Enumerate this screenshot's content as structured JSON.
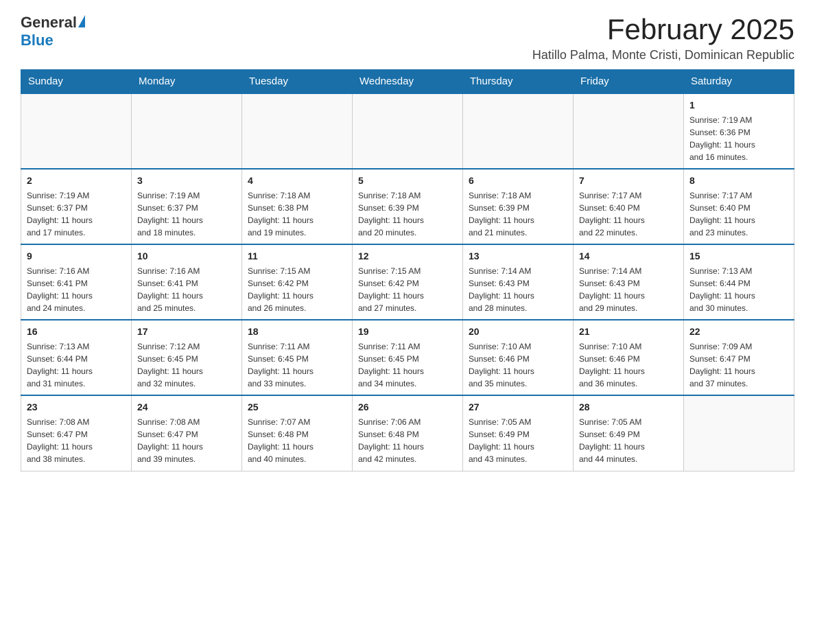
{
  "header": {
    "logo_general": "General",
    "logo_blue": "Blue",
    "month_title": "February 2025",
    "location": "Hatillo Palma, Monte Cristi, Dominican Republic"
  },
  "days_of_week": [
    "Sunday",
    "Monday",
    "Tuesday",
    "Wednesday",
    "Thursday",
    "Friday",
    "Saturday"
  ],
  "weeks": [
    [
      {
        "day": "",
        "info": ""
      },
      {
        "day": "",
        "info": ""
      },
      {
        "day": "",
        "info": ""
      },
      {
        "day": "",
        "info": ""
      },
      {
        "day": "",
        "info": ""
      },
      {
        "day": "",
        "info": ""
      },
      {
        "day": "1",
        "info": "Sunrise: 7:19 AM\nSunset: 6:36 PM\nDaylight: 11 hours\nand 16 minutes."
      }
    ],
    [
      {
        "day": "2",
        "info": "Sunrise: 7:19 AM\nSunset: 6:37 PM\nDaylight: 11 hours\nand 17 minutes."
      },
      {
        "day": "3",
        "info": "Sunrise: 7:19 AM\nSunset: 6:37 PM\nDaylight: 11 hours\nand 18 minutes."
      },
      {
        "day": "4",
        "info": "Sunrise: 7:18 AM\nSunset: 6:38 PM\nDaylight: 11 hours\nand 19 minutes."
      },
      {
        "day": "5",
        "info": "Sunrise: 7:18 AM\nSunset: 6:39 PM\nDaylight: 11 hours\nand 20 minutes."
      },
      {
        "day": "6",
        "info": "Sunrise: 7:18 AM\nSunset: 6:39 PM\nDaylight: 11 hours\nand 21 minutes."
      },
      {
        "day": "7",
        "info": "Sunrise: 7:17 AM\nSunset: 6:40 PM\nDaylight: 11 hours\nand 22 minutes."
      },
      {
        "day": "8",
        "info": "Sunrise: 7:17 AM\nSunset: 6:40 PM\nDaylight: 11 hours\nand 23 minutes."
      }
    ],
    [
      {
        "day": "9",
        "info": "Sunrise: 7:16 AM\nSunset: 6:41 PM\nDaylight: 11 hours\nand 24 minutes."
      },
      {
        "day": "10",
        "info": "Sunrise: 7:16 AM\nSunset: 6:41 PM\nDaylight: 11 hours\nand 25 minutes."
      },
      {
        "day": "11",
        "info": "Sunrise: 7:15 AM\nSunset: 6:42 PM\nDaylight: 11 hours\nand 26 minutes."
      },
      {
        "day": "12",
        "info": "Sunrise: 7:15 AM\nSunset: 6:42 PM\nDaylight: 11 hours\nand 27 minutes."
      },
      {
        "day": "13",
        "info": "Sunrise: 7:14 AM\nSunset: 6:43 PM\nDaylight: 11 hours\nand 28 minutes."
      },
      {
        "day": "14",
        "info": "Sunrise: 7:14 AM\nSunset: 6:43 PM\nDaylight: 11 hours\nand 29 minutes."
      },
      {
        "day": "15",
        "info": "Sunrise: 7:13 AM\nSunset: 6:44 PM\nDaylight: 11 hours\nand 30 minutes."
      }
    ],
    [
      {
        "day": "16",
        "info": "Sunrise: 7:13 AM\nSunset: 6:44 PM\nDaylight: 11 hours\nand 31 minutes."
      },
      {
        "day": "17",
        "info": "Sunrise: 7:12 AM\nSunset: 6:45 PM\nDaylight: 11 hours\nand 32 minutes."
      },
      {
        "day": "18",
        "info": "Sunrise: 7:11 AM\nSunset: 6:45 PM\nDaylight: 11 hours\nand 33 minutes."
      },
      {
        "day": "19",
        "info": "Sunrise: 7:11 AM\nSunset: 6:45 PM\nDaylight: 11 hours\nand 34 minutes."
      },
      {
        "day": "20",
        "info": "Sunrise: 7:10 AM\nSunset: 6:46 PM\nDaylight: 11 hours\nand 35 minutes."
      },
      {
        "day": "21",
        "info": "Sunrise: 7:10 AM\nSunset: 6:46 PM\nDaylight: 11 hours\nand 36 minutes."
      },
      {
        "day": "22",
        "info": "Sunrise: 7:09 AM\nSunset: 6:47 PM\nDaylight: 11 hours\nand 37 minutes."
      }
    ],
    [
      {
        "day": "23",
        "info": "Sunrise: 7:08 AM\nSunset: 6:47 PM\nDaylight: 11 hours\nand 38 minutes."
      },
      {
        "day": "24",
        "info": "Sunrise: 7:08 AM\nSunset: 6:47 PM\nDaylight: 11 hours\nand 39 minutes."
      },
      {
        "day": "25",
        "info": "Sunrise: 7:07 AM\nSunset: 6:48 PM\nDaylight: 11 hours\nand 40 minutes."
      },
      {
        "day": "26",
        "info": "Sunrise: 7:06 AM\nSunset: 6:48 PM\nDaylight: 11 hours\nand 42 minutes."
      },
      {
        "day": "27",
        "info": "Sunrise: 7:05 AM\nSunset: 6:49 PM\nDaylight: 11 hours\nand 43 minutes."
      },
      {
        "day": "28",
        "info": "Sunrise: 7:05 AM\nSunset: 6:49 PM\nDaylight: 11 hours\nand 44 minutes."
      },
      {
        "day": "",
        "info": ""
      }
    ]
  ]
}
